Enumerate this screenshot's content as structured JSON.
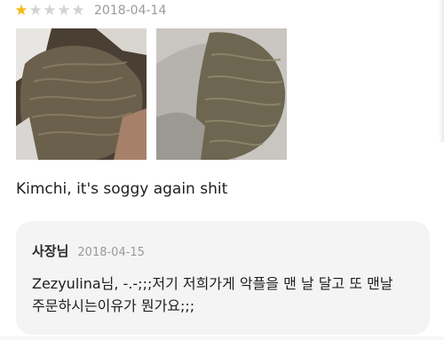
{
  "colors": {
    "star_on": "#f5b914",
    "star_off": "#d3d3d3",
    "reply_bg": "#f4f4f4"
  },
  "review": {
    "rating": 1,
    "rating_max": 5,
    "stars": [
      "★",
      "★",
      "★",
      "★",
      "★"
    ],
    "date": "2018-04-14",
    "photos": [
      {
        "icon": "noodle-photo",
        "name": "review-photo-1"
      },
      {
        "icon": "noodle-photo",
        "name": "review-photo-2"
      }
    ],
    "text": "Kimchi, it's soggy again shit"
  },
  "reply": {
    "author": "사장님",
    "date": "2018-04-15",
    "text": "Zezyulina님, -.-;;;저기 저희가게 악플을 맨 날 달고 또 맨날\n주문하시는이유가 뭔가요;;;"
  }
}
